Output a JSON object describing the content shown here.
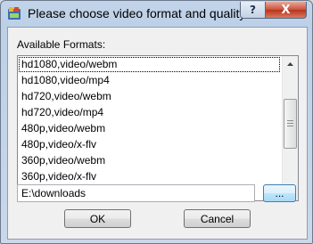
{
  "window": {
    "title": "Please choose video format and quality:",
    "help_glyph": "?",
    "close_glyph": "X"
  },
  "formats": {
    "label": "Available Formats:",
    "items": [
      "hd1080,video/webm",
      "hd1080,video/mp4",
      "hd720,video/webm",
      "hd720,video/mp4",
      "480p,video/webm",
      "480p,video/x-flv",
      "360p,video/webm",
      "360p,video/x-flv"
    ],
    "selected_index": 0
  },
  "path": {
    "value": "E:\\downloads"
  },
  "buttons": {
    "browse": "...",
    "ok": "OK",
    "cancel": "Cancel"
  },
  "icons": {
    "app": "app-icon",
    "help": "help-icon",
    "close": "close-icon",
    "scroll_up": "scroll-up-arrow-icon",
    "scroll_down": "scroll-down-arrow-icon"
  }
}
